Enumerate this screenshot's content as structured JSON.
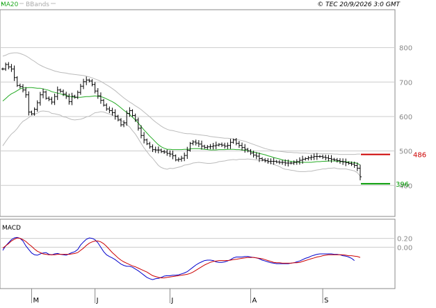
{
  "header": {
    "ma_label": "MA20",
    "bbands_label": "BBands",
    "copyright": "© TEC 20/9/2026 3:0 GMT"
  },
  "colors": {
    "ma": "#22aa22",
    "bbands": "#bbbbbb",
    "price": "#000000",
    "grid": "#cccccc",
    "resistance": "#cc0000",
    "support": "#009900",
    "macd_line": "#0000cc",
    "signal_line": "#cc0000",
    "tick_label": "#888888"
  },
  "chart_data": [
    {
      "type": "ohlc",
      "title": "",
      "ylim": [
        310,
        910
      ],
      "y_ticks": [
        "800",
        "700",
        "600",
        "500",
        "400"
      ],
      "x_labels": [
        "M",
        "J",
        "J",
        "A",
        "S"
      ],
      "x_label_index": [
        10,
        32,
        58,
        86,
        111
      ],
      "n_bars": 125,
      "close": [
        738,
        751,
        744,
        738,
        713,
        690,
        687,
        677,
        663,
        613,
        608,
        621,
        640,
        663,
        671,
        653,
        650,
        642,
        658,
        677,
        673,
        665,
        658,
        643,
        659,
        656,
        670,
        688,
        701,
        706,
        703,
        693,
        674,
        660,
        647,
        633,
        622,
        617,
        611,
        601,
        590,
        576,
        582,
        609,
        617,
        603,
        590,
        566,
        545,
        532,
        521,
        512,
        504,
        503,
        503,
        498,
        497,
        493,
        491,
        486,
        474,
        476,
        479,
        487,
        502,
        522,
        526,
        523,
        520,
        514,
        510,
        512,
        513,
        515,
        517,
        519,
        517,
        514,
        516,
        525,
        532,
        522,
        516,
        510,
        505,
        500,
        494,
        488,
        485,
        478,
        474,
        472,
        470,
        470,
        470,
        468,
        467,
        467,
        465,
        465,
        465,
        467,
        469,
        473,
        476,
        478,
        480,
        482,
        484,
        484,
        484,
        482,
        480,
        478,
        476,
        474,
        472,
        470,
        468,
        466,
        464,
        462,
        458,
        450,
        425
      ],
      "ma20": [
        645,
        652,
        660,
        666,
        670,
        675,
        680,
        683,
        683,
        684,
        684,
        683,
        682,
        682,
        680,
        678,
        676,
        672,
        670,
        668,
        666,
        663,
        662,
        659,
        657,
        656,
        656,
        656,
        657,
        658,
        658,
        659,
        660,
        659,
        658,
        655,
        651,
        647,
        643,
        638,
        632,
        625,
        618,
        612,
        606,
        598,
        590,
        581,
        571,
        561,
        552,
        543,
        535,
        526,
        518,
        512,
        508,
        505,
        505,
        504,
        504,
        504,
        504,
        505,
        505,
        506,
        507,
        507,
        507,
        506,
        505,
        504,
        503,
        503,
        503,
        504,
        504,
        504,
        505,
        505,
        505,
        504,
        504,
        503,
        502,
        501,
        499,
        497,
        495,
        493,
        491,
        489,
        486,
        484,
        481,
        479,
        477,
        474,
        472,
        471,
        470,
        469,
        468,
        467,
        467,
        467,
        467,
        467,
        468,
        469,
        469,
        470,
        470,
        471,
        471,
        471,
        470,
        469,
        469,
        469,
        468,
        467,
        466,
        464,
        459
      ],
      "bb_upper": [
        775,
        778,
        782,
        784,
        785,
        785,
        783,
        780,
        776,
        771,
        765,
        760,
        754,
        749,
        745,
        741,
        738,
        735,
        732,
        730,
        728,
        727,
        726,
        724,
        723,
        722,
        721,
        720,
        719,
        717,
        715,
        712,
        709,
        706,
        702,
        697,
        692,
        687,
        681,
        675,
        668,
        661,
        654,
        648,
        642,
        637,
        631,
        626,
        620,
        613,
        606,
        599,
        591,
        584,
        578,
        572,
        567,
        563,
        560,
        559,
        557,
        555,
        553,
        551,
        550,
        550,
        549,
        548,
        547,
        546,
        545,
        544,
        542,
        541,
        540,
        539,
        538,
        537,
        537,
        536,
        535,
        534,
        532,
        530,
        528,
        525,
        522,
        519,
        516,
        513,
        510,
        507,
        505,
        503,
        501,
        500,
        499,
        498,
        497,
        496,
        496,
        495,
        495,
        494,
        494,
        494,
        493,
        493,
        493,
        493,
        492,
        492,
        492,
        492,
        492,
        491,
        491,
        490,
        490,
        490,
        490,
        490,
        490,
        491,
        491
      ],
      "bb_lower": [
        515,
        527,
        539,
        549,
        556,
        565,
        577,
        586,
        591,
        597,
        603,
        606,
        610,
        615,
        616,
        615,
        614,
        609,
        608,
        606,
        604,
        599,
        598,
        594,
        591,
        590,
        591,
        592,
        595,
        599,
        601,
        606,
        611,
        612,
        614,
        613,
        610,
        607,
        605,
        601,
        596,
        589,
        582,
        576,
        570,
        559,
        549,
        536,
        522,
        509,
        498,
        487,
        479,
        468,
        458,
        452,
        449,
        447,
        450,
        449,
        451,
        453,
        455,
        459,
        460,
        462,
        465,
        466,
        467,
        466,
        465,
        464,
        464,
        465,
        466,
        469,
        470,
        471,
        473,
        474,
        475,
        474,
        476,
        476,
        476,
        477,
        476,
        475,
        474,
        473,
        472,
        471,
        467,
        465,
        461,
        458,
        455,
        450,
        447,
        446,
        444,
        443,
        441,
        440,
        440,
        440,
        441,
        441,
        443,
        445,
        446,
        448,
        448,
        450,
        450,
        451,
        449,
        448,
        448,
        448,
        446,
        444,
        442,
        437,
        427
      ],
      "macd": [
        -7,
        3,
        10,
        17,
        21,
        22,
        20,
        14,
        3,
        -5,
        -13,
        -17,
        -18,
        -15,
        -13,
        -12,
        -16,
        -17,
        -15,
        -14,
        -16,
        -17,
        -18,
        -15,
        -12,
        -10,
        -5,
        5,
        12,
        18,
        21,
        20,
        17,
        10,
        0,
        -10,
        -17,
        -21,
        -24,
        -28,
        -33,
        -38,
        -41,
        -43,
        -43,
        -45,
        -49,
        -53,
        -58,
        -63,
        -68,
        -71,
        -73,
        -71,
        -70,
        -68,
        -65,
        -64,
        -64,
        -63,
        -63,
        -62,
        -60,
        -58,
        -55,
        -50,
        -45,
        -40,
        -36,
        -33,
        -30,
        -29,
        -29,
        -30,
        -33,
        -34,
        -34,
        -33,
        -31,
        -28,
        -24,
        -22,
        -22,
        -22,
        -21,
        -21,
        -22,
        -23,
        -24,
        -26,
        -29,
        -31,
        -33,
        -35,
        -36,
        -37,
        -37,
        -37,
        -37,
        -37,
        -36,
        -35,
        -33,
        -31,
        -28,
        -25,
        -23,
        -20,
        -18,
        -16,
        -15,
        -15,
        -15,
        -15,
        -15,
        -16,
        -16,
        -17,
        -19,
        -20,
        -22,
        -25,
        -30
      ],
      "signal": [
        -2,
        3,
        8,
        14,
        18,
        21,
        20,
        17,
        13,
        7,
        2,
        -4,
        -9,
        -12,
        -15,
        -16,
        -17,
        -17,
        -17,
        -16,
        -16,
        -16,
        -16,
        -16,
        -15,
        -14,
        -12,
        -7,
        -2,
        4,
        9,
        12,
        14,
        14,
        12,
        8,
        2,
        -5,
        -12,
        -18,
        -24,
        -29,
        -33,
        -36,
        -39,
        -42,
        -44,
        -47,
        -50,
        -53,
        -56,
        -60,
        -64,
        -66,
        -68,
        -69,
        -69,
        -68,
        -67,
        -66,
        -65,
        -64,
        -63,
        -62,
        -61,
        -59,
        -56,
        -52,
        -48,
        -44,
        -40,
        -37,
        -34,
        -32,
        -31,
        -30,
        -30,
        -30,
        -30,
        -29,
        -28,
        -27,
        -26,
        -25,
        -24,
        -23,
        -23,
        -23,
        -24,
        -25,
        -26,
        -28,
        -30,
        -32,
        -34,
        -35,
        -35,
        -36,
        -36,
        -36,
        -36,
        -35,
        -35,
        -34,
        -32,
        -30,
        -28,
        -26,
        -24,
        -22,
        -21,
        -19,
        -18,
        -17,
        -17,
        -17,
        -17,
        -17,
        -17,
        -18,
        -19,
        -19,
        -20,
        -21,
        -23
      ]
    },
    {
      "type": "line",
      "title": "MACD",
      "ylim": [
        -90,
        60
      ],
      "y_ticks": [
        "0.20",
        "0.00"
      ]
    }
  ],
  "levels": {
    "resistance": {
      "label": "486",
      "value": 490
    },
    "support": {
      "label": "396",
      "value": 405
    }
  }
}
